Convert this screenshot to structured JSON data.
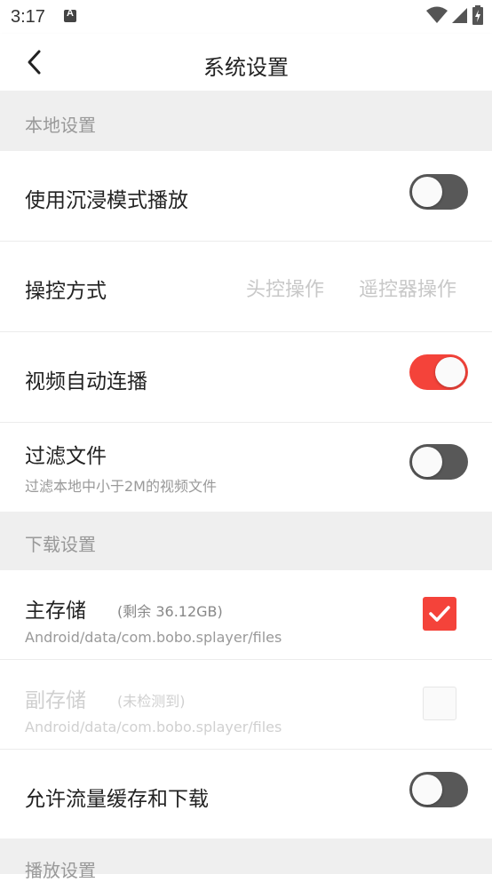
{
  "status_bar": {
    "time": "3:17",
    "notification_icon": "A"
  },
  "header": {
    "title": "系统设置",
    "back_icon": "chevron-left-icon"
  },
  "sections": {
    "local": {
      "label": "本地设置"
    },
    "download": {
      "label": "下载设置"
    },
    "playback": {
      "label": "播放设置"
    }
  },
  "local_settings": {
    "immersive": {
      "title": "使用沉浸模式播放",
      "enabled": false
    },
    "control": {
      "title": "操控方式",
      "options": [
        "头控操作",
        "遥控器操作"
      ]
    },
    "autoplay": {
      "title": "视频自动连播",
      "enabled": true
    },
    "filter": {
      "title": "过滤文件",
      "subtitle": "过滤本地中小于2M的视频文件",
      "enabled": false
    }
  },
  "download_settings": {
    "primary": {
      "title": "主存储",
      "extra": "(剩余  36.12GB)",
      "path": "Android/data/com.bobo.splayer/files",
      "checked": true
    },
    "secondary": {
      "title": "副存储",
      "extra": "(未检测到)",
      "path": "Android/data/com.bobo.splayer/files",
      "checked": false,
      "disabled": true
    },
    "cellular": {
      "title": "允许流量缓存和下载",
      "enabled": false
    }
  },
  "colors": {
    "accent": "#f4433a",
    "toggle_off": "#585858",
    "section_bg": "#efefef"
  }
}
